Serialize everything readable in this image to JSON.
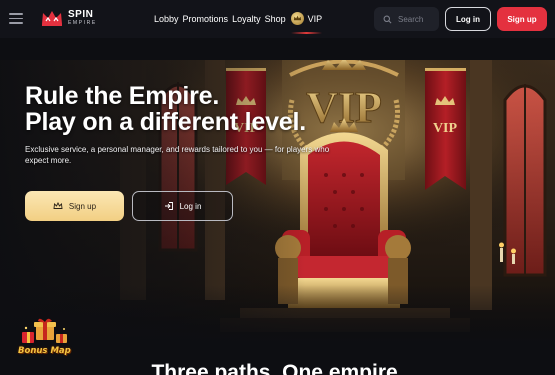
{
  "brand": {
    "name": "SPIN",
    "subname": "EMPIRE",
    "accent": "#e4313f"
  },
  "nav": {
    "items": [
      "Lobby",
      "Promotions",
      "Loyalty",
      "Shop"
    ],
    "vip_label": "VIP"
  },
  "search": {
    "placeholder": "Search"
  },
  "header_buttons": {
    "login": "Log in",
    "signup": "Sign up"
  },
  "hero": {
    "title_line1": "Rule the Empire.",
    "title_line2": "Play on a different level.",
    "subtitle": "Exclusive service, a personal manager, and rewards tailored to you — for players who expect more.",
    "signup_label": "Sign up",
    "login_label": "Log in",
    "banner_text": "VIP",
    "gold": "#f2cf83"
  },
  "bonus_map": {
    "label": "Bonus Map"
  },
  "section": {
    "title": "Three paths. One empire."
  }
}
